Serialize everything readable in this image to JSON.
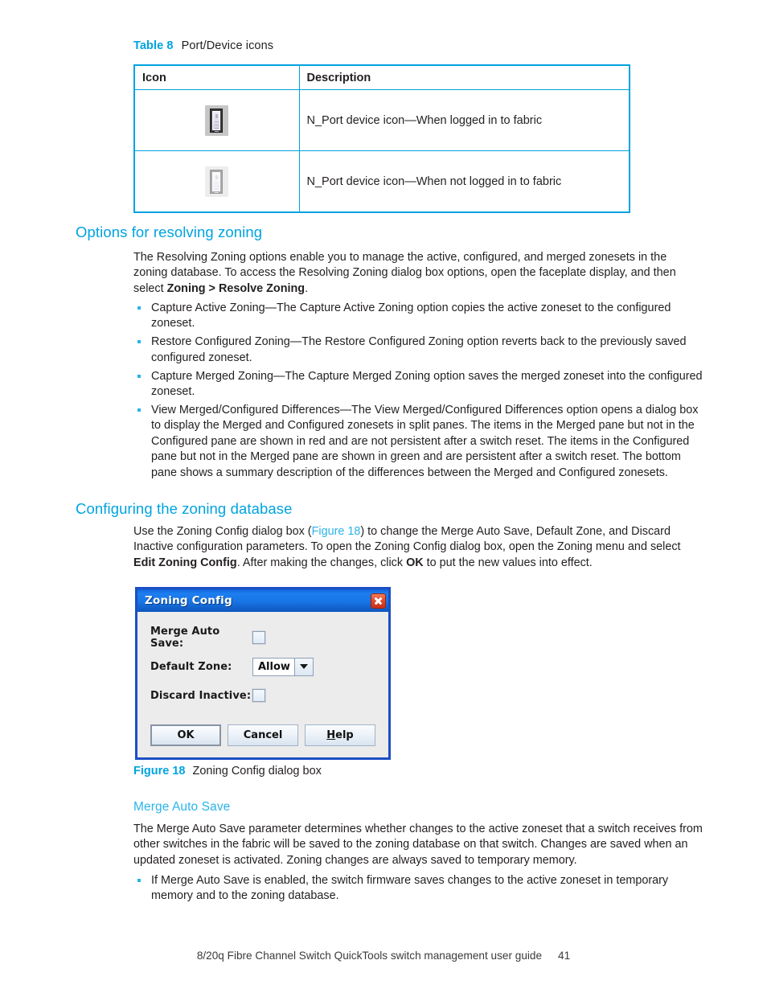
{
  "table": {
    "caption_label": "Table 8",
    "caption_text": "Port/Device icons",
    "headers": [
      "Icon",
      "Description"
    ],
    "border_color": "#00a3e0",
    "rows": [
      {
        "icon": "nport-logged-in-icon",
        "description": "N_Port device icon—When logged in to fabric"
      },
      {
        "icon": "nport-not-logged-in-icon",
        "description": "N_Port device icon—When not logged in to fabric"
      }
    ]
  },
  "sections": {
    "options_heading": "Options for resolving zoning",
    "options_intro_1": "The Resolving Zoning options enable you to manage the active, configured, and merged zonesets in the zoning database. To access the Resolving Zoning dialog box options, open the faceplate display, and then select ",
    "options_intro_bold": "Zoning > Resolve Zoning",
    "options_intro_end": ".",
    "bullets": [
      "Capture Active Zoning—The Capture Active Zoning option copies the active zoneset to the configured zoneset.",
      "Restore Configured Zoning—The Restore Configured Zoning option reverts back to the previously saved configured zoneset.",
      "Capture Merged Zoning—The Capture Merged Zoning option saves the merged zoneset into the configured zoneset.",
      "View Merged/Configured Differences—The View Merged/Configured Differences option opens a dialog box to display the Merged and Configured zonesets in split panes. The items in the Merged pane but not in the Configured pane are shown in red and are not persistent after a switch reset. The items in the Configured pane but not in the Merged pane are shown in green and are persistent after a switch reset. The bottom pane shows a summary description of the differences between the Merged and Configured zonesets."
    ],
    "configuring_heading": "Configuring the zoning database",
    "configuring_p_1": "Use the Zoning Config dialog box (",
    "configuring_p_link": "Figure 18",
    "configuring_p_2": ") to change the Merge Auto Save, Default Zone, and Discard Inactive configuration parameters. To open the Zoning Config dialog box, open the Zoning menu and select ",
    "configuring_p_bold_1": "Edit Zoning Config",
    "configuring_p_3": ". After making the changes, click ",
    "configuring_p_bold_2": "OK",
    "configuring_p_4": " to put the new values into effect.",
    "merge_heading": "Merge Auto Save",
    "merge_para": "The Merge Auto Save parameter determines whether changes to the active zoneset that a switch receives from other switches in the fabric will be saved to the zoning database on that switch. Changes are saved when an updated zoneset is activated. Zoning changes are always saved to temporary memory.",
    "merge_bullets": [
      "If Merge Auto Save is enabled, the switch firmware saves changes to the active zoneset in temporary memory and to the zoning database."
    ]
  },
  "dialog": {
    "title": "Zoning Config",
    "close_icon": "close-icon",
    "titlebar_color": "#1874e4",
    "border_color": "#1b4fc4",
    "fields": [
      {
        "label": "Merge Auto Save:",
        "type": "checkbox",
        "checked": false
      },
      {
        "label": "Default Zone:",
        "type": "combobox",
        "value": "Allow"
      },
      {
        "label": "Discard Inactive:",
        "type": "checkbox",
        "checked": false
      }
    ],
    "buttons": [
      {
        "label": "OK",
        "default": true
      },
      {
        "label": "Cancel",
        "default": false
      },
      {
        "label": "Help",
        "mnemonic": "H",
        "default": false
      }
    ]
  },
  "figure": {
    "caption_label": "Figure 18",
    "caption_text": "Zoning Config dialog box"
  },
  "footer": {
    "text": "8/20q Fibre Channel Switch QuickTools switch management user guide",
    "page": "41"
  }
}
